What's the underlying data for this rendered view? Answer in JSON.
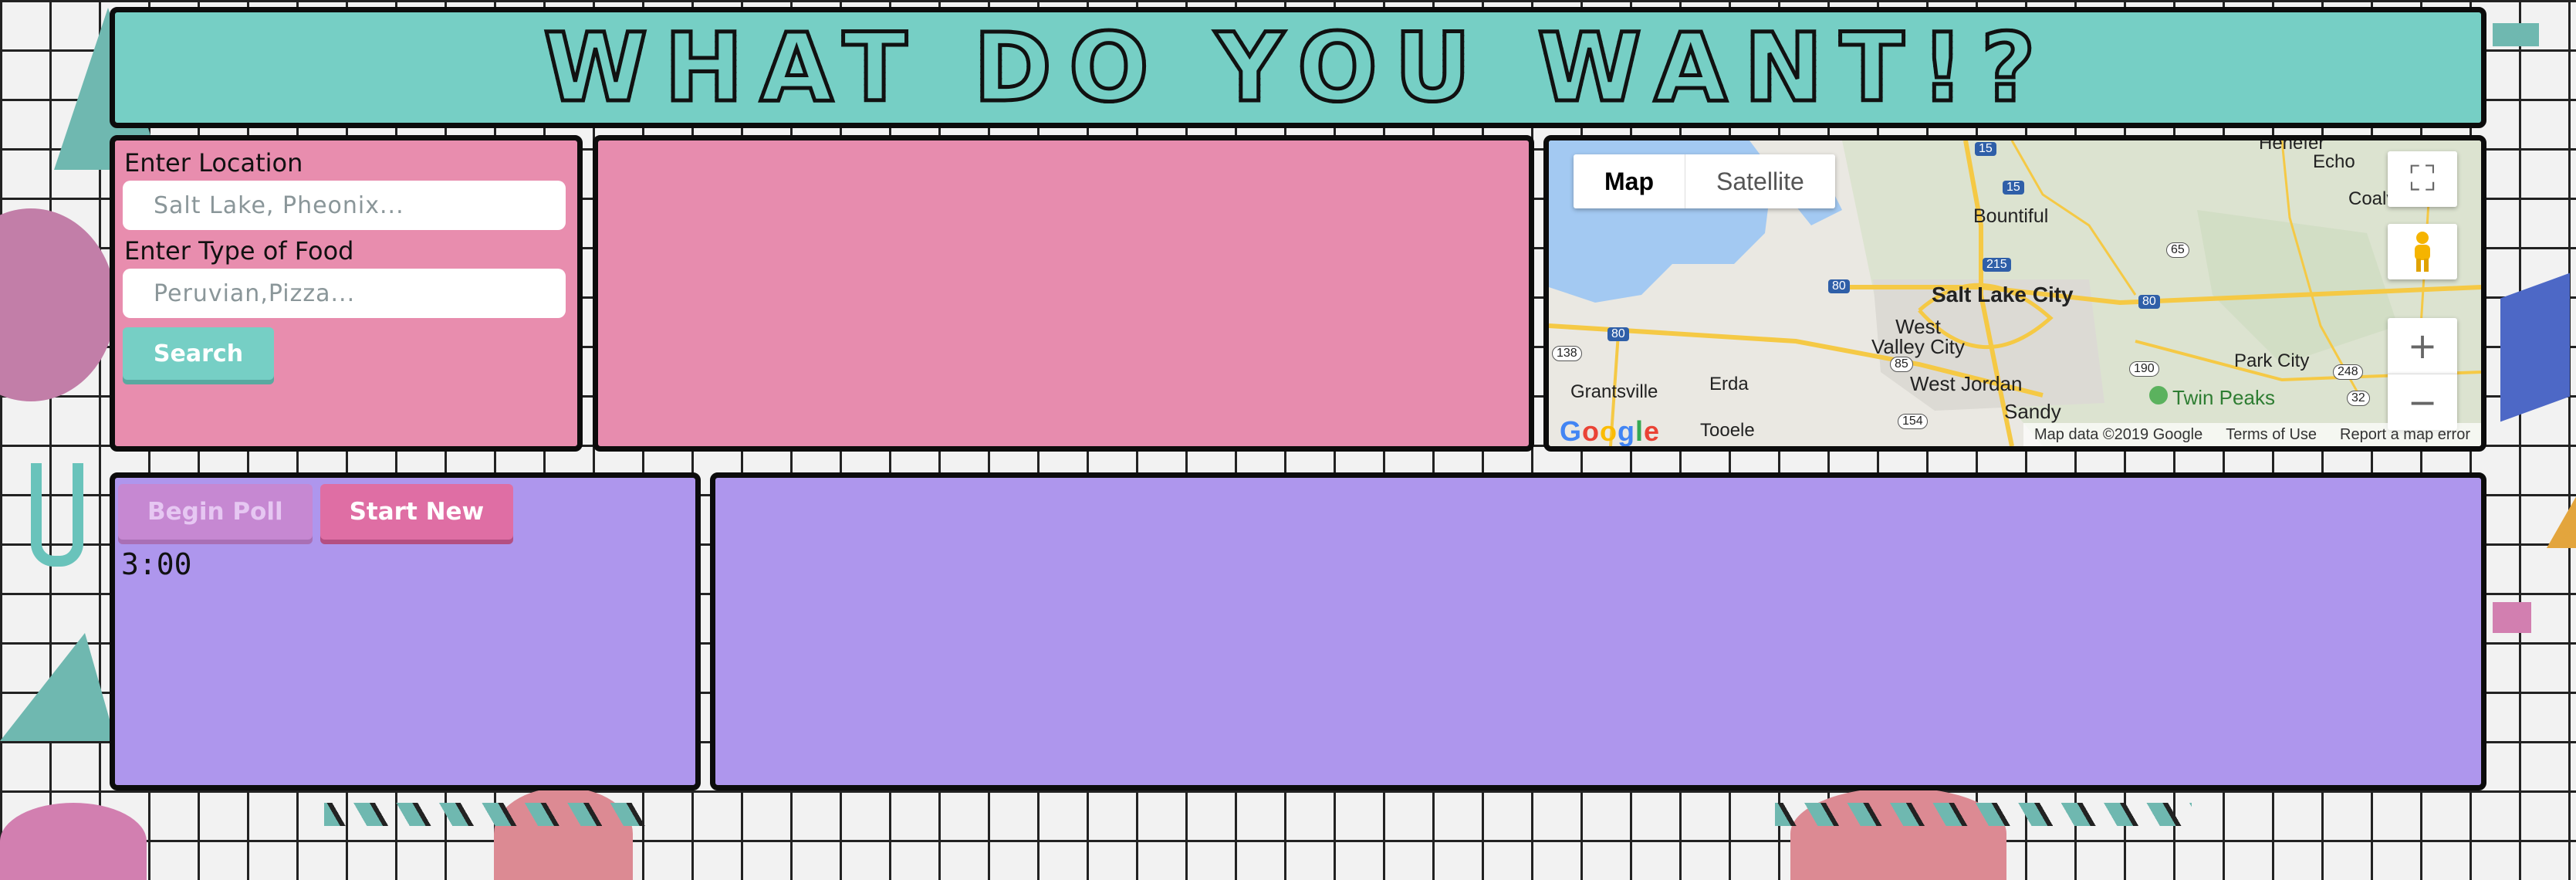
{
  "header": {
    "title": "WHAT DO YOU WANT!?"
  },
  "search": {
    "location_label": "Enter Location",
    "location_placeholder": "Salt Lake, Pheonix...",
    "food_label": "Enter Type of Food",
    "food_placeholder": "Peruvian,Pizza...",
    "search_button": "Search"
  },
  "map": {
    "type_map": "Map",
    "type_satellite": "Satellite",
    "fullscreen_icon": "⛶",
    "zoom_in": "+",
    "zoom_out": "−",
    "data_credit": "Map data ©2019 Google",
    "terms": "Terms of Use",
    "report": "Report a map error",
    "places": {
      "echo": "Echo",
      "henefer": "Henefer",
      "coalville": "Coalville",
      "bountiful": "Bountiful",
      "slc": "Salt Lake City",
      "west_valley": "West\nValley City",
      "park_city": "Park City",
      "grantsville": "Grantsville",
      "erda": "Erda",
      "west_jordan": "West Jordan",
      "sandy": "Sandy",
      "twin_peaks": "Twin Peaks",
      "tooele": "Tooele"
    },
    "shields": {
      "i15a": "15",
      "i15b": "15",
      "i215": "215",
      "i80a": "80",
      "i80b": "80",
      "i80c": "80",
      "r65": "65",
      "r138": "138",
      "r85": "85",
      "r190": "190",
      "r248": "248",
      "r32": "32",
      "r154": "154"
    },
    "google_letters": [
      "G",
      "o",
      "o",
      "g",
      "l",
      "e"
    ],
    "google_colors": [
      "#4285F4",
      "#EA4335",
      "#FBBC05",
      "#4285F4",
      "#34A853",
      "#EA4335"
    ]
  },
  "poll": {
    "begin_button": "Begin Poll",
    "start_new_button": "Start New",
    "timer": "3:00"
  }
}
